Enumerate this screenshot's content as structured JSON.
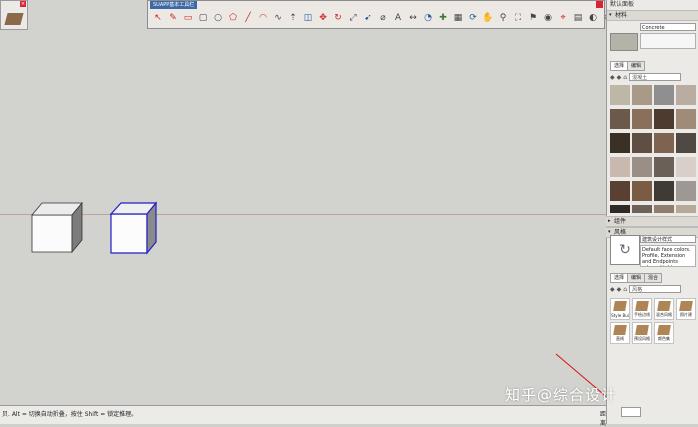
{
  "toolbar": {
    "title": "SUAPP基本工具栏",
    "tool_icons": [
      "select-icon",
      "paint-icon",
      "eraser-icon",
      "rect-icon",
      "circle-icon",
      "polygon-icon",
      "line-icon",
      "arc-icon",
      "freehand-icon",
      "pushpull-icon",
      "offset-icon",
      "move-icon",
      "rotate-icon",
      "scale-icon",
      "followme-icon",
      "tape-icon",
      "text-icon",
      "dim-icon",
      "protractor-icon",
      "axes-icon",
      "section-icon",
      "orbit-icon",
      "pan-icon",
      "zoom-icon",
      "zoom-extents-icon",
      "walk-icon",
      "look-icon",
      "position-icon",
      "sandbox-icon",
      "shadow-icon",
      "fog-icon",
      "su-logo-icon"
    ]
  },
  "tray": {
    "title": "默认面板",
    "materials_section": "材料",
    "material_name": "Concrete",
    "tabs": [
      "选择",
      "编辑"
    ],
    "library": "混凝土",
    "swatch_colors": [
      "#bdb7a8",
      "#a89a86",
      "#8f8f8f",
      "#b8ada0",
      "#6b5a4b",
      "#8a6f5a",
      "#4e3b2f",
      "#a08a78",
      "#3b3026",
      "#5f4f43",
      "#7d6350",
      "#504842",
      "#c9b8ae",
      "#9a8f86",
      "#6a6058",
      "#d8cfc8",
      "#5a4030",
      "#7a5c44",
      "#3f3a36",
      "#9d9894",
      "#2e2925",
      "#6d625a",
      "#8f7e70",
      "#b7a898"
    ],
    "components_section": "组件",
    "styles_section": "风格",
    "style_name": "建筑设计样式",
    "style_desc": "Default face colors. Profile, Extension and Endpoints edges. Light",
    "style_tabs": [
      "选择",
      "编辑",
      "混合"
    ],
    "style_library": "风格",
    "style_items": [
      "Style Bui",
      "手绘边线",
      "混合风格",
      "照片建",
      "直线",
      "预设风格",
      "颜色集"
    ]
  },
  "status": {
    "message": "贝. Alt = 切换自动折叠，按住 Shift = 锁定推理。",
    "distance_label": "距离"
  },
  "watermark": "知乎@综合设计"
}
